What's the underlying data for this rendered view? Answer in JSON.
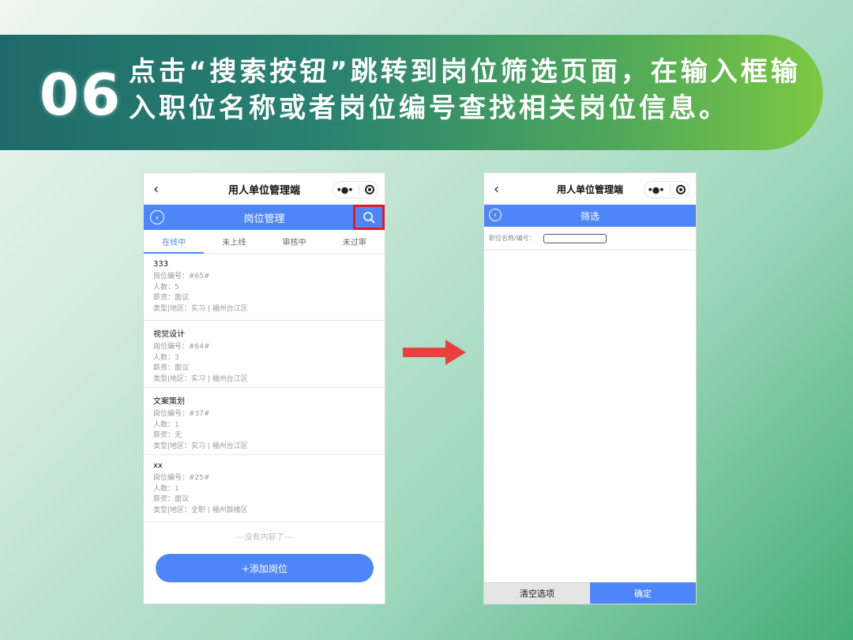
{
  "banner": {
    "step_number": "06",
    "instruction": "点击“搜索按钮”跳转到岗位筛选页面，在输入框输入职位名称或者岗位编号查找相关岗位信息。"
  },
  "colors": {
    "accent_blue": "#4f86f7",
    "highlight_red": "#e21b1b",
    "arrow_red": "#e8423f"
  },
  "left_phone": {
    "app_title": "用人单位管理端",
    "back_glyph": "‹",
    "capsule_menu": "•●•",
    "page_title": "岗位管理",
    "tabs": [
      {
        "label": "在线中",
        "active": true
      },
      {
        "label": "未上线",
        "active": false
      },
      {
        "label": "审核中",
        "active": false
      },
      {
        "label": "未过审",
        "active": false
      }
    ],
    "jobs": [
      {
        "title": "333",
        "code": "岗位编号：#65#",
        "count": "人数：5",
        "salary": "薪资：面议",
        "type_area": "类型|地区：实习 | 福州台江区"
      },
      {
        "title": "视觉设计",
        "code": "岗位编号：#64#",
        "count": "人数：3",
        "salary": "薪资：面议",
        "type_area": "类型|地区：实习 | 福州台江区"
      },
      {
        "title": "文案策划",
        "code": "岗位编号：#37#",
        "count": "人数：1",
        "salary": "薪资：无",
        "type_area": "类型|地区：实习 | 福州台江区"
      },
      {
        "title": "xx",
        "code": "岗位编号：#25#",
        "count": "人数：1",
        "salary": "薪资：面议",
        "type_area": "类型|地区：全职 | 福州鼓楼区"
      }
    ],
    "empty_tip": "---没有内容了---",
    "add_button": "+添加岗位"
  },
  "right_phone": {
    "app_title": "用人单位管理端",
    "back_glyph": "‹",
    "capsule_menu": "•●•",
    "page_title": "筛选",
    "filter_label": "职位名称/编号：",
    "filter_value": "",
    "clear_button": "清空选项",
    "confirm_button": "确定"
  }
}
